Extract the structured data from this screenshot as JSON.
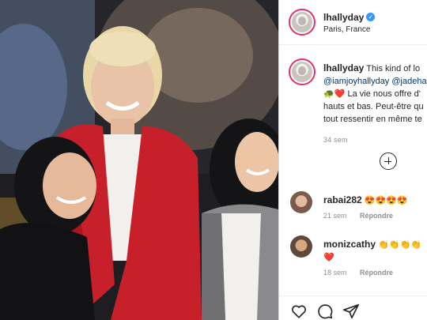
{
  "post": {
    "author": {
      "username": "lhallyday",
      "verified": true,
      "location": "Paris, France"
    },
    "caption": {
      "line1": "This kind of lo",
      "line2_mentions": "@iamjoyhallyday @jadeha",
      "line3": "La vie nous offre d'",
      "line4": "hauts et bas. Peut-être qu",
      "line5": "tout ressentir en même te",
      "timestamp": "34 sem",
      "emojis": "🐢❤️"
    },
    "comments": [
      {
        "username": "rabai282",
        "text": "😍😍😍😍",
        "time": "21 sem",
        "reply_label": "Répondre"
      },
      {
        "username": "monizcathy",
        "text": "👏👏👏👏",
        "text_line2": "❤️",
        "time": "18 sem",
        "reply_label": "Répondre"
      }
    ],
    "actions": {
      "like_icon": "heart-icon",
      "comment_icon": "comment-icon",
      "share_icon": "share-icon"
    },
    "colors": {
      "verified_blue": "#3897f0",
      "link_blue": "#00376b",
      "secondary_text": "#8e8e8e",
      "red_jacket": "#c8202a",
      "border": "#dbdbdb"
    }
  }
}
